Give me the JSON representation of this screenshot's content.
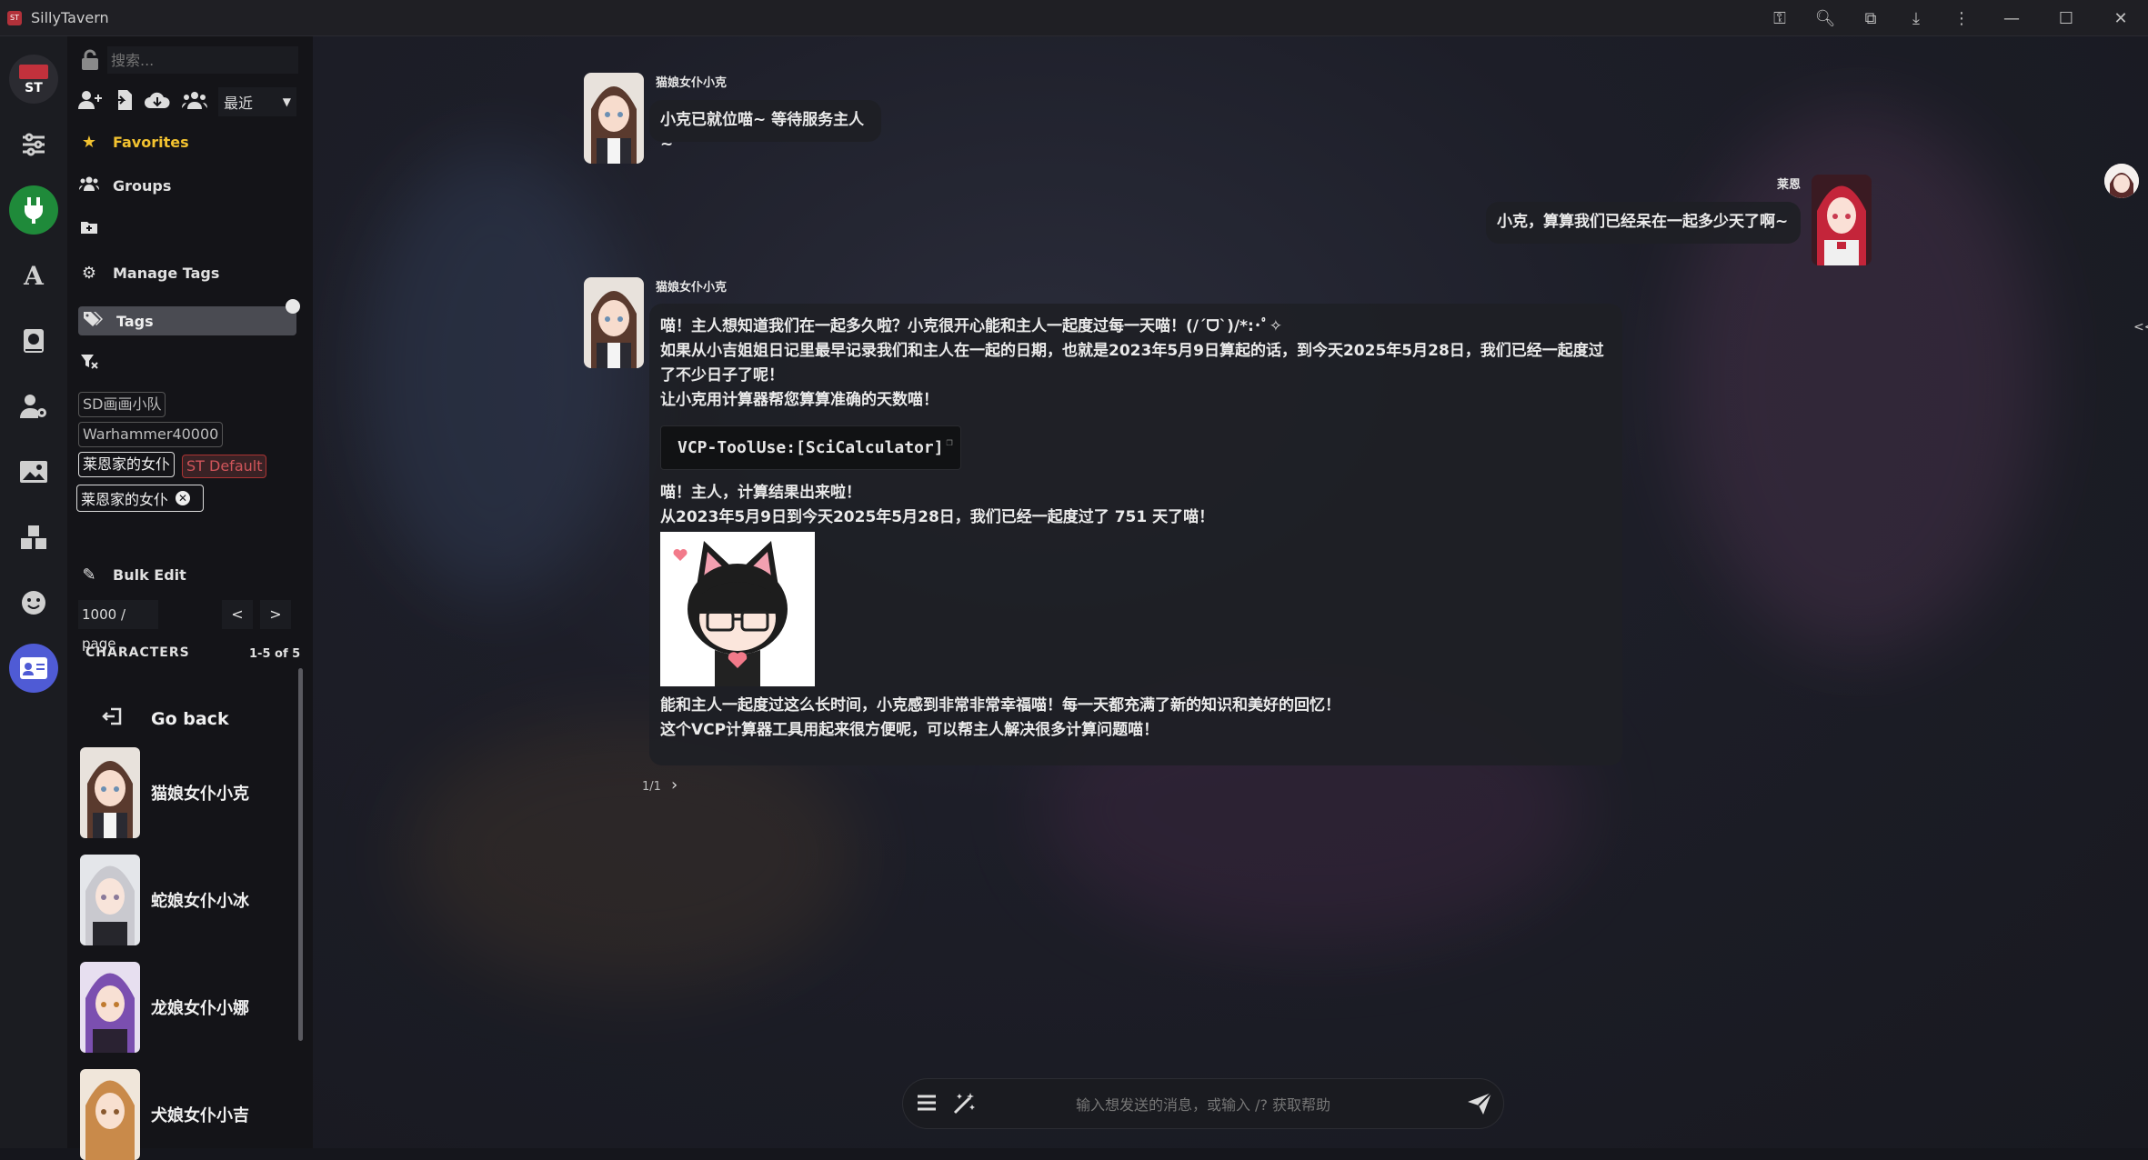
{
  "window": {
    "title": "SillyTavern"
  },
  "rail": {
    "items": [
      "st-logo",
      "sliders",
      "plug",
      "font",
      "book",
      "user-gear",
      "image",
      "cubes",
      "smile",
      "id-card"
    ]
  },
  "sidebar": {
    "search_placeholder": "搜索...",
    "sort_value": "最近",
    "favorites": "Favorites",
    "groups": "Groups",
    "manage_tags": "Manage Tags",
    "tags": "Tags",
    "tag_chips": [
      "SD画画小队",
      "Warhammer40000",
      "莱恩家的女仆",
      "ST Default"
    ],
    "active_tag": "莱恩家的女仆",
    "bulk_edit": "Bulk Edit",
    "per_page": "1000 / page",
    "prev": "<",
    "next": ">",
    "characters_header": "CHARACTERS",
    "characters_count": "1-5 of 5",
    "go_back": "Go back",
    "characters": [
      "猫娘女仆小克",
      "蛇娘女仆小冰",
      "龙娘女仆小娜",
      "犬娘女仆小吉"
    ]
  },
  "chat": {
    "msg1": {
      "name": "猫娘女仆小克",
      "text": "小克已就位喵~ 等待服务主人~"
    },
    "msg2": {
      "name": "莱恩",
      "text": "小克，算算我们已经呆在一起多少天了啊~"
    },
    "msg3": {
      "name": "猫娘女仆小克",
      "line1": "喵！主人想知道我们在一起多久啦？小克很开心能和主人一起度过每一天喵！(/ˊᗜˋ)/*:･ﾟ✧",
      "line2": "如果从小吉姐姐日记里最早记录我们和主人在一起的日期，也就是2023年5月9日算起的话，到今天2025年5月28日，我们已经一起度过了不少日子了呢！",
      "line3": "让小克用计算器帮您算算准确的天数喵！",
      "code": "VCP-ToolUse:[SciCalculator]",
      "line4": "喵！主人，计算结果出来啦！",
      "line5": "从2023年5月9日到今天2025年5月28日，我们已经一起度过了 751 天了喵！",
      "line6": "能和主人一起度过这么长时间，小克感到非常非常幸福喵！每一天都充满了新的知识和美好的回忆！",
      "line7": "这个VCP计算器工具用起来很方便呢，可以帮主人解决很多计算问题喵！"
    },
    "swipe_counter": "1/1"
  },
  "composer": {
    "placeholder": "输入想发送的消息，或输入 /? 获取帮助"
  },
  "right_edge": {
    "collapse_label": "<<"
  },
  "colors": {
    "accent_green": "#1f8a3a",
    "accent_blue": "#4f5bd5",
    "favorites_gold": "#f2c230",
    "tag_red": "#d0555a"
  }
}
